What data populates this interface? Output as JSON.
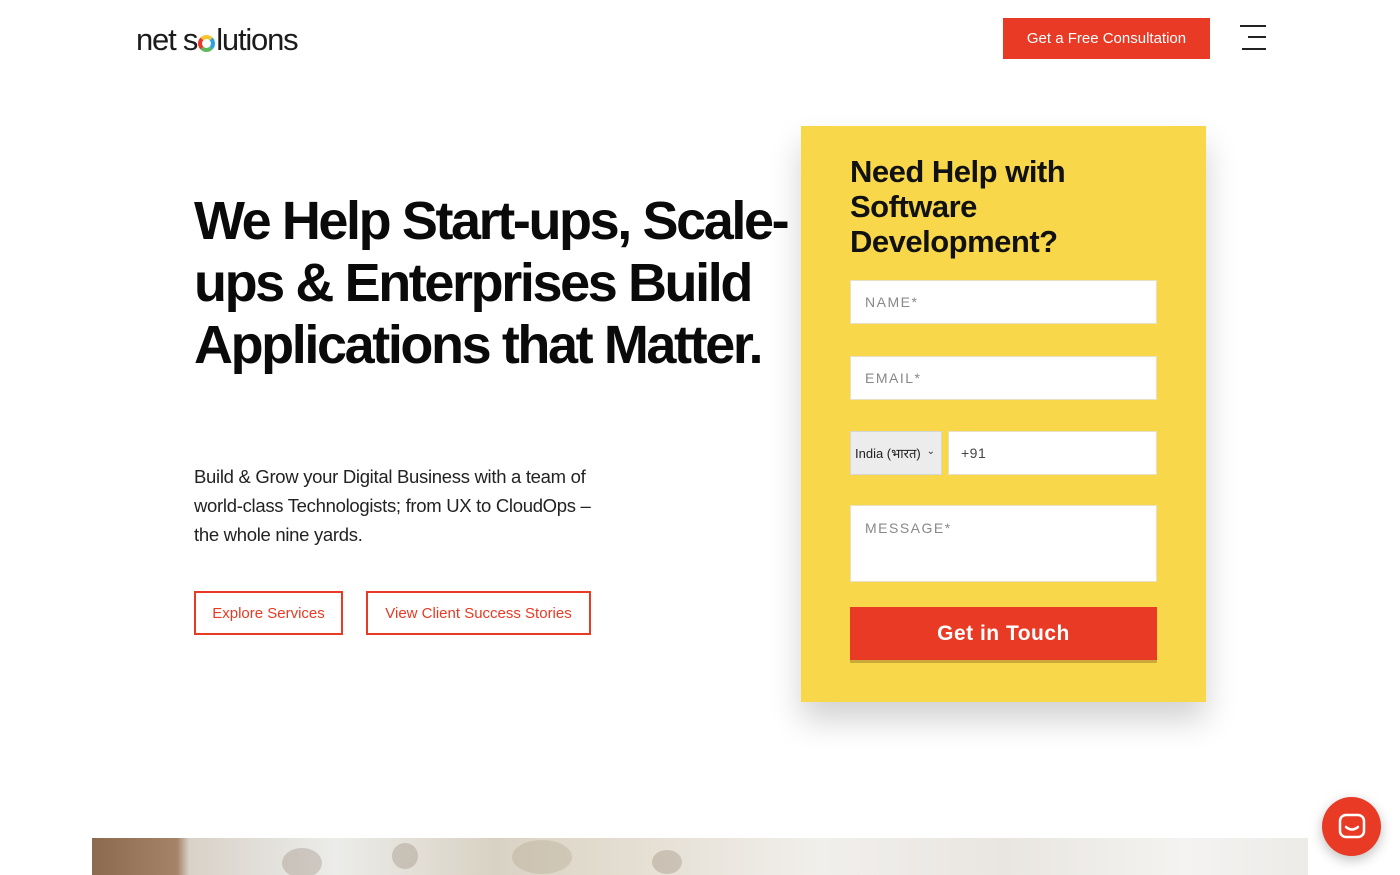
{
  "header": {
    "logo_text_a": "net s",
    "logo_text_b": "lutions",
    "cta_label": "Get a Free Consultation",
    "menu_icon": "hamburger-menu-icon"
  },
  "hero": {
    "title": "We Help Start-ups, Scale-ups & Enterprises Build Applications that Matter.",
    "subtitle": "Build & Grow your Digital Business with a team of world-class Technologists; from UX to CloudOps – the whole nine yards.",
    "explore_label": "Explore Services",
    "stories_label": "View Client Success Stories"
  },
  "form": {
    "title": "Need Help with Software Development?",
    "name_placeholder": "NAME*",
    "email_placeholder": "EMAIL*",
    "country_value": "India (भारत)",
    "phone_value": "+91",
    "message_placeholder": "MESSAGE*",
    "submit_label": "Get in Touch"
  },
  "chat": {
    "icon": "chat-icon"
  },
  "colors": {
    "accent": "#e83a24",
    "form_bg": "#f8d84a"
  }
}
